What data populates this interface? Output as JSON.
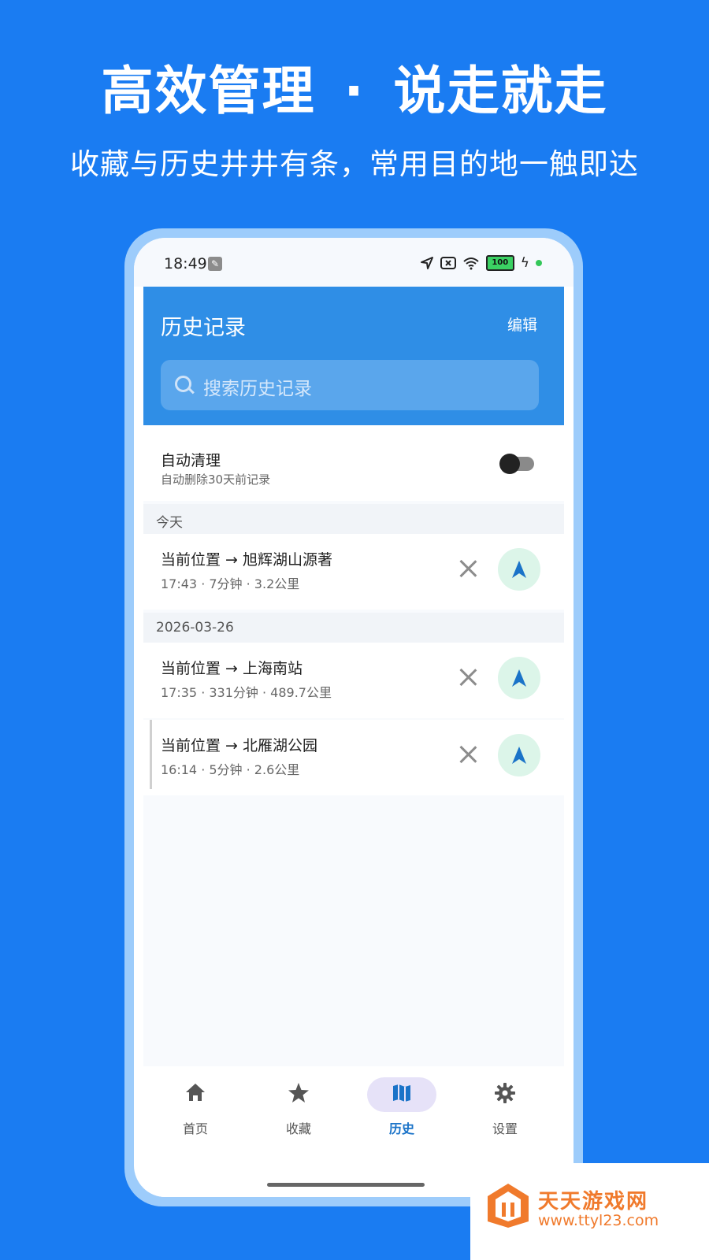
{
  "promo": {
    "headline_left": "高效管理",
    "headline_dot": "·",
    "headline_right": "说走就走",
    "subheadline": "收藏与历史井井有条，常用目的地一触即达"
  },
  "statusbar": {
    "time": "18:49",
    "battery": "100",
    "icons": [
      "wrench-icon",
      "location-arrow-icon",
      "sim-off-icon",
      "wifi-icon",
      "battery-icon",
      "charging-icon"
    ]
  },
  "appbar": {
    "title": "历史记录",
    "edit_label": "编辑",
    "search_placeholder": "搜索历史记录"
  },
  "auto_clean": {
    "title": "自动清理",
    "subtitle": "自动删除30天前记录",
    "enabled": false
  },
  "groups": [
    {
      "header": "今天",
      "items": [
        {
          "title": "当前位置 → 旭辉湖山源著",
          "meta": "17:43 · 7分钟 · 3.2公里"
        }
      ]
    },
    {
      "header": "2026-03-26",
      "items": [
        {
          "title": "当前位置 → 上海南站",
          "meta": "17:35 · 331分钟 · 489.7公里"
        },
        {
          "title": "当前位置 → 北雁湖公园",
          "meta": "16:14 · 5分钟 · 2.6公里"
        }
      ]
    }
  ],
  "bottom_nav": {
    "tabs": [
      {
        "label": "首页",
        "icon": "home-icon"
      },
      {
        "label": "收藏",
        "icon": "star-icon"
      },
      {
        "label": "历史",
        "icon": "map-icon"
      },
      {
        "label": "设置",
        "icon": "gear-icon"
      }
    ],
    "active": "历史"
  },
  "watermark": {
    "title": "天天游戏网",
    "url": "www.ttyl23.com"
  },
  "colors": {
    "background": "#1a7cf2",
    "appbar": "#2f8ee6",
    "nav_button_bg": "#dcf5e9",
    "active_tab": "#1a73c8"
  }
}
